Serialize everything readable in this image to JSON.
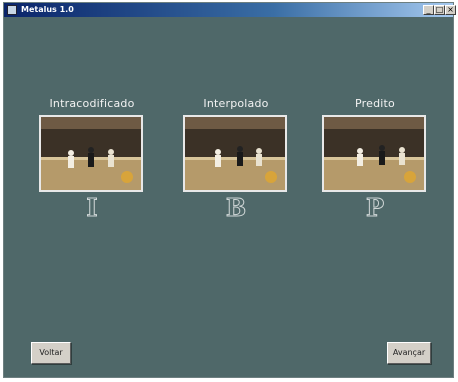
{
  "window": {
    "title": "Metalus 1.0",
    "controls": [
      "_",
      "□",
      "×"
    ]
  },
  "frames": [
    {
      "label": "Intracodificado",
      "letter": "I"
    },
    {
      "label": "Interpolado",
      "letter": "B"
    },
    {
      "label": "Predito",
      "letter": "P"
    }
  ],
  "buttons": {
    "back": "Voltar",
    "next": "Avançar"
  },
  "colors": {
    "background": "#4f6869",
    "titlebar": "#0a246a"
  }
}
